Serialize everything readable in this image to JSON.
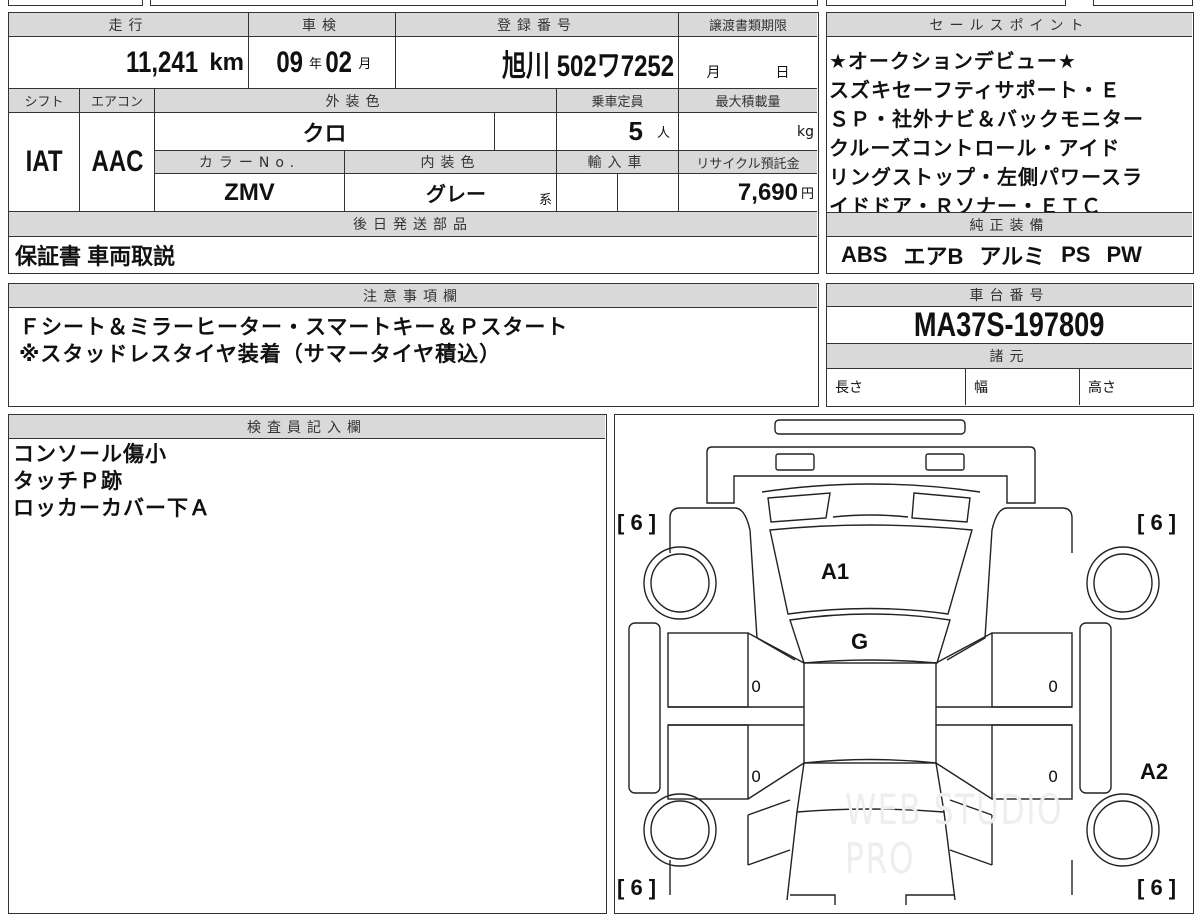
{
  "vehicle": {
    "headers": {
      "mileage": "走行",
      "inspection": "車検",
      "registration": "登録番号",
      "transfer_deadline": "譲渡書類期限",
      "shift": "シフト",
      "aircon": "エアコン",
      "exterior_color": "外装色",
      "capacity": "乗車定員",
      "max_load": "最大積載量",
      "color_no": "カラーNo.",
      "interior_color": "内装色",
      "imported": "輸入車",
      "recycle_fee": "リサイクル預託金",
      "later_parts": "後日発送部品"
    },
    "mileage": "11,241",
    "mileage_unit": "km",
    "inspection_year": "09",
    "year_unit": "年",
    "inspection_month": "02",
    "month_unit": "月",
    "registration": "旭川 502ワ7252",
    "transfer_month": "月",
    "transfer_day": "日",
    "shift": "IAT",
    "aircon": "AAC",
    "exterior_color": "クロ",
    "capacity": "5",
    "capacity_unit": "人",
    "max_load_unit": "kg",
    "color_no": "ZMV",
    "interior_color": "グレー",
    "interior_suffix": "系",
    "recycle_fee": "7,690",
    "recycle_unit": "円",
    "later_parts": "保証書 車両取説"
  },
  "sales_points": {
    "header": "セールスポイント",
    "lines": [
      "★オークションデビュー★",
      "スズキセーフティサポート・Ｅ",
      "ＳＰ・社外ナビ＆バックモニター",
      "クルーズコントロール・アイド",
      "リングストップ・左側パワースラ",
      "イドドア・Ｒソナー・ＥＴＣ"
    ]
  },
  "equipment": {
    "header": "純正装備",
    "items": [
      "ABS",
      "エアB",
      "アルミ",
      "PS",
      "PW"
    ]
  },
  "notes": {
    "header": "注意事項欄",
    "lines": [
      "Ｆシート＆ミラーヒーター・スマートキー＆Ｐスタート",
      "※スタッドレスタイヤ装着（サマータイヤ積込）"
    ]
  },
  "chassis": {
    "header": "車台番号",
    "number": "MA37S-197809",
    "spec_header": "諸元",
    "length": "長さ",
    "width": "幅",
    "height": "高さ"
  },
  "inspector": {
    "header": "検査員記入欄",
    "lines": [
      "コンソール傷小",
      "タッチＰ跡",
      "ロッカーカバー下Ａ"
    ]
  },
  "diagram": {
    "tire_fl": "[ 6 ]",
    "tire_fr": "[ 6 ]",
    "tire_rl": "[ 6 ]",
    "tire_rr": "[ 6 ]",
    "hood": "A1",
    "windshield": "G",
    "side_right": "A2",
    "door_marks": [
      "0",
      "0",
      "0",
      "0"
    ],
    "watermark": "WEB STUDIO PRO"
  }
}
